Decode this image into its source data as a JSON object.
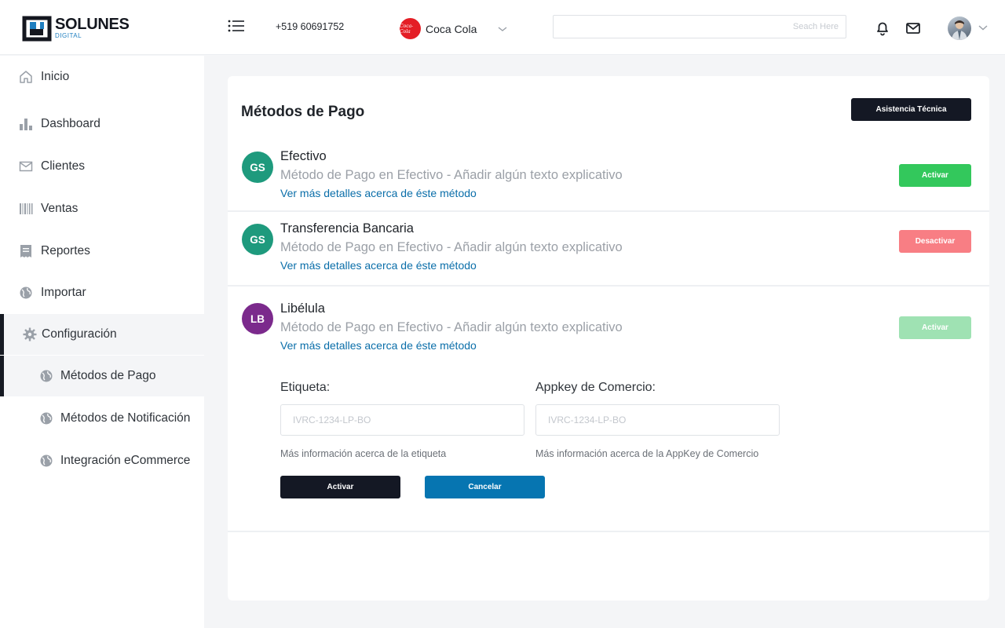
{
  "header": {
    "logo": {
      "word": "SOLUNES",
      "sub": "DIGITAL"
    },
    "phone": "+519 60691752",
    "brand": {
      "name": "Coca Cola",
      "logo_text": "Coca-Cola",
      "logo_color": "#e41e26"
    },
    "search": {
      "placeholder": "Seach Here",
      "value": ""
    },
    "icons": [
      "menu-icon",
      "bell-icon",
      "mail-icon",
      "chevron-down-icon"
    ]
  },
  "sidebar": {
    "items": [
      {
        "label": "Inicio",
        "icon": "home-icon"
      },
      {
        "label": "Dashboard",
        "icon": "bar-chart-icon"
      },
      {
        "label": "Clientes",
        "icon": "envelope-icon"
      },
      {
        "label": "Ventas",
        "icon": "barcode-icon"
      },
      {
        "label": "Reportes",
        "icon": "receipt-icon"
      },
      {
        "label": "Importar",
        "icon": "globe-icon"
      },
      {
        "label": "Configuración",
        "icon": "gear-icon",
        "active": true
      }
    ],
    "subitems": [
      {
        "label": "Métodos de Pago",
        "icon": "globe-icon",
        "active": true
      },
      {
        "label": "Métodos de Notificación",
        "icon": "globe-icon"
      },
      {
        "label": "Integración eCommerce",
        "icon": "globe-icon"
      }
    ]
  },
  "main": {
    "title": "Métodos de Pago",
    "help_button": "Asistencia Técnica",
    "methods": [
      {
        "initials": "GS",
        "avatar_color": "#1e9a7d",
        "name": "Efectivo",
        "description": "Método de Pago en Efectivo - Añadir algún texto explicativo",
        "link": "Ver más detalles acerca de éste método",
        "button": "Activar",
        "button_state": "activate"
      },
      {
        "initials": "GS",
        "avatar_color": "#1e9a7d",
        "name": "Transferencia Bancaria",
        "description": "Método de Pago en Efectivo - Añadir algún texto explicativo",
        "link": "Ver más detalles acerca de éste método",
        "button": "Desactivar",
        "button_state": "deactivate"
      },
      {
        "initials": "LB",
        "avatar_color": "#7b2a8c",
        "name": "Libélula",
        "description": "Método de Pago en Efectivo - Añadir algún texto explicativo",
        "link": "Ver más detalles acerca de éste método",
        "button": "Activar",
        "button_state": "disabled"
      }
    ],
    "form": {
      "etiqueta": {
        "label": "Etiqueta:",
        "placeholder": "IVRC-1234-LP-BO",
        "value": "",
        "help": "Más información acerca de la etiqueta"
      },
      "appkey": {
        "label": "Appkey de Comercio:",
        "placeholder": "IVRC-1234-LP-BO",
        "value": "",
        "help": "Más información acerca de la AppKey de Comercio"
      },
      "submit_label": "Activar",
      "cancel_label": "Cancelar"
    }
  }
}
